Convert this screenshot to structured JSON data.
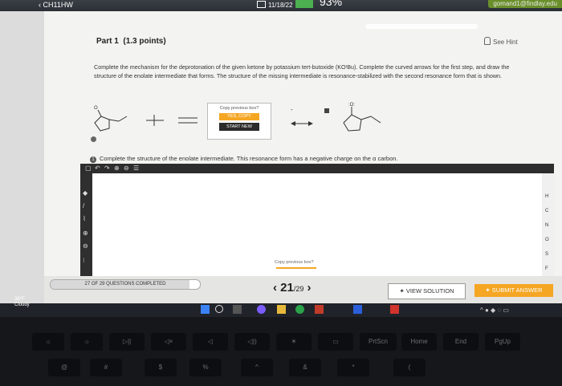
{
  "topbar": {
    "back_label": "CH11HW",
    "date": "11/18/22",
    "battery": "93%",
    "user": "gomand1@findlay.edu"
  },
  "question": {
    "part_title": "Part 1",
    "points": "(1.3 points)",
    "hint_label": "See Hint",
    "instructions": "Complete the mechanism for the deprotonation of the given ketone by potassium tert-butoxide (KOᵗBu). Complete the curved arrows for the first step, and draw the structure of the enolate intermediate that forms. The structure of the missing intermediate is resonance-stabilized with the second resonance form that is shown.",
    "copy_prompt": "Copy previous box?",
    "yes_copy": "YES, COPY",
    "start_new": "START NEW",
    "step2_num": "1",
    "step2_text": "Complete the structure of the enolate intermediate. This resonance form has a negative charge on the α carbon."
  },
  "editor": {
    "atoms": [
      "H",
      "C",
      "N",
      "O",
      "S",
      "F"
    ],
    "copy_prompt": "Copy previous box?"
  },
  "footer": {
    "progress_text": "27 OF 29 QUESTIONS COMPLETED",
    "progress_fraction": 0.93,
    "page_current": "21",
    "page_total": "/29",
    "view_solution": "VIEW SOLUTION",
    "submit": "SUBMIT ANSWER"
  },
  "taskbar": {
    "temp": "38°F",
    "condition": "Cloudy"
  },
  "keyboard": {
    "fn_keys": [
      "PrtScn",
      "Home",
      "End",
      "PgUp"
    ]
  }
}
